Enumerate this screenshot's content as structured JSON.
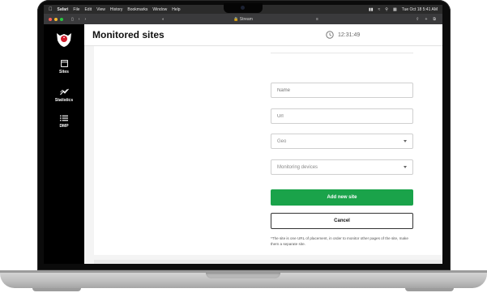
{
  "menubar": {
    "apple": "",
    "items": [
      "Safari",
      "File",
      "Edit",
      "View",
      "History",
      "Bookmarks",
      "Window",
      "Help"
    ],
    "datetime": "Tue Oct 18 5:41 AM"
  },
  "browser": {
    "url": "Stream"
  },
  "sidebar": {
    "items": [
      {
        "label": "Sites",
        "icon": "window-icon"
      },
      {
        "label": "Statistics",
        "icon": "chart-line-icon"
      },
      {
        "label": "DMP",
        "icon": "list-icon"
      }
    ]
  },
  "header": {
    "title": "Monitored sites",
    "time": "12:31:49"
  },
  "form": {
    "name_placeholder": "Name",
    "url_placeholder": "Url",
    "geo_label": "Geo",
    "devices_label": "Monitoring devices",
    "add_label": "Add new site",
    "cancel_label": "Cancel",
    "note": "*The site is one URL of placement, in order to monitor other pages of the site, make them a separate site."
  },
  "colors": {
    "accent": "#1aa34a",
    "sidebar_bg": "#000000",
    "logo_red": "#d11a2a"
  }
}
